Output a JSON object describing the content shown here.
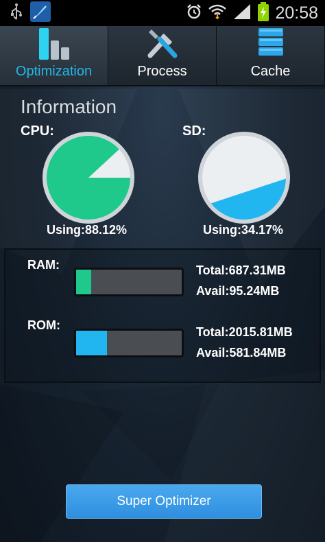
{
  "status_bar": {
    "time": "20:58",
    "icons": [
      "usb-icon",
      "app-rocket-icon",
      "alarm-icon",
      "wifi-icon",
      "signal-icon",
      "battery-charging-icon"
    ]
  },
  "tabs": [
    {
      "label": "Optimization",
      "icon": "bar-chart-icon",
      "active": true
    },
    {
      "label": "Process",
      "icon": "tools-icon",
      "active": false
    },
    {
      "label": "Cache",
      "icon": "database-icon",
      "active": false
    }
  ],
  "info": {
    "title": "Information",
    "cpu": {
      "label": "CPU:",
      "using_text": "Using:88.12%",
      "percent": 88.12,
      "color": "#1ec98b"
    },
    "sd": {
      "label": "SD:",
      "using_text": "Using:34.17%",
      "percent": 34.17,
      "color": "#22b6f0"
    }
  },
  "memory": {
    "ram": {
      "label": "RAM:",
      "total": "Total:687.31MB",
      "avail": "Avail:95.24MB",
      "used_fraction": 0.14,
      "color": "#1ec98b"
    },
    "rom": {
      "label": "ROM:",
      "total": "Total:2015.81MB",
      "avail": "Avail:581.84MB",
      "used_fraction": 0.29,
      "color": "#22b6f0"
    }
  },
  "actions": {
    "super_optimizer": "Super Optimizer"
  },
  "colors": {
    "accent": "#25b7e8",
    "button": "#3b9be6",
    "track": "#4a4e52"
  }
}
